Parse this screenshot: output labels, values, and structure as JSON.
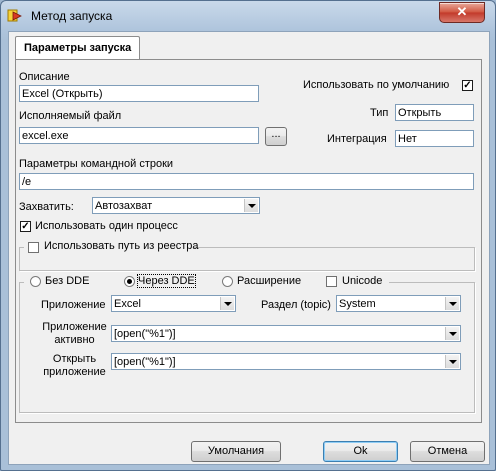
{
  "window": {
    "title": "Метод запуска",
    "close_label": "✕"
  },
  "tab": {
    "label": "Параметры запуска"
  },
  "description": {
    "label": "Описание",
    "value": "Excel (Открыть)"
  },
  "use_default": {
    "label": "Использовать по умолчанию",
    "checked": true
  },
  "type": {
    "label": "Тип",
    "value": "Открыть"
  },
  "executable": {
    "label": "Исполняемый файл",
    "value": "excel.exe",
    "browse_label": "..."
  },
  "integration": {
    "label": "Интеграция",
    "value": "Нет"
  },
  "cmdline": {
    "label": "Параметры командной строки",
    "value": "/e"
  },
  "capture": {
    "label": "Захватить:",
    "value": "Автозахват"
  },
  "single_process": {
    "label": "Использовать один процесс",
    "checked": true
  },
  "registry_path": {
    "label": "Использовать путь из реестра",
    "checked": false
  },
  "dde": {
    "options": [
      "Без DDE",
      "Через DDE",
      "Расширение"
    ],
    "selected": "Через DDE",
    "unicode_label": "Unicode",
    "unicode_checked": false,
    "application_label": "Приложение",
    "application_value": "Excel",
    "topic_label": "Раздел (topic)",
    "topic_value": "System",
    "app_active_label_1": "Приложение",
    "app_active_label_2": "активно",
    "app_active_value": "[open(\"%1\")]",
    "open_app_label_1": "Открыть",
    "open_app_label_2": "приложение",
    "open_app_value": "[open(\"%1\")]"
  },
  "buttons": {
    "defaults": "Умолчания",
    "ok": "Ok",
    "cancel": "Отмена"
  }
}
